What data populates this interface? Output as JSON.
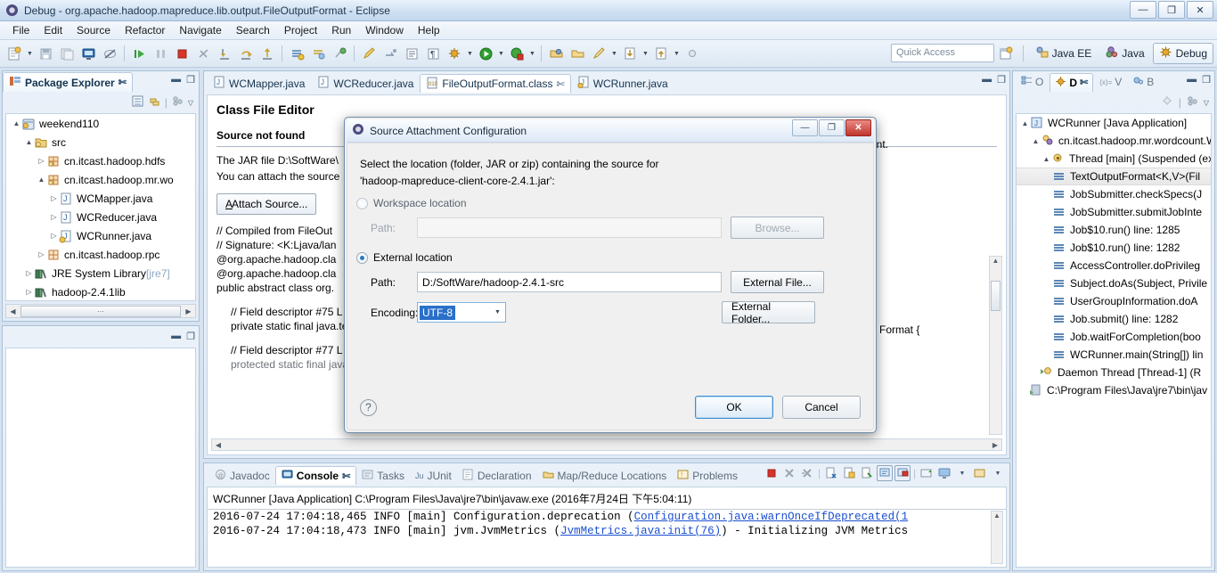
{
  "window": {
    "title": "Debug - org.apache.hadoop.mapreduce.lib.output.FileOutputFormat - Eclipse",
    "minimize": "—",
    "restore": "❐",
    "close": "✕"
  },
  "menu": [
    "File",
    "Edit",
    "Source",
    "Refactor",
    "Navigate",
    "Search",
    "Project",
    "Run",
    "Window",
    "Help"
  ],
  "toolbar": {
    "quick_access_placeholder": "Quick Access",
    "perspectives": [
      {
        "label": "Java EE",
        "active": false
      },
      {
        "label": "Java",
        "active": false
      },
      {
        "label": "Debug",
        "active": true
      }
    ]
  },
  "package_explorer": {
    "tab_label": "Package Explorer",
    "tree": [
      {
        "indent": 0,
        "twisty": "▲",
        "icon": "project",
        "label": "weekend110"
      },
      {
        "indent": 1,
        "twisty": "▲",
        "icon": "srcfolder",
        "label": "src"
      },
      {
        "indent": 2,
        "twisty": "▷",
        "icon": "package",
        "label": "cn.itcast.hadoop.hdfs"
      },
      {
        "indent": 2,
        "twisty": "▲",
        "icon": "package",
        "label": "cn.itcast.hadoop.mr.wo"
      },
      {
        "indent": 3,
        "twisty": "▷",
        "icon": "javafile",
        "label": "WCMapper.java"
      },
      {
        "indent": 3,
        "twisty": "▷",
        "icon": "javafile",
        "label": "WCReducer.java"
      },
      {
        "indent": 3,
        "twisty": "▷",
        "icon": "javafile-warn",
        "label": "WCRunner.java"
      },
      {
        "indent": 2,
        "twisty": "▷",
        "icon": "package-plain",
        "label": "cn.itcast.hadoop.rpc"
      },
      {
        "indent": 1,
        "twisty": "▷",
        "icon": "library",
        "label": "JRE System Library ",
        "suffix": "[jre7]"
      },
      {
        "indent": 1,
        "twisty": "▷",
        "icon": "library",
        "label": "hadoop-2.4.1lib"
      }
    ]
  },
  "editor": {
    "tabs": [
      {
        "label": "WCMapper.java",
        "icon": "java-file-icon",
        "active": false
      },
      {
        "label": "WCReducer.java",
        "icon": "java-file-icon",
        "active": false
      },
      {
        "label": "FileOutputFormat.class",
        "icon": "class-file-icon",
        "active": true
      },
      {
        "label": "WCRunner.java",
        "icon": "java-warn-file-icon",
        "active": false
      }
    ],
    "class_file_editor_title": "Class File Editor",
    "source_not_found_title": "Source not found",
    "message_line1": "The JAR file D:\\SoftWare\\",
    "message_line2": "You can attach the source",
    "message_right_fragment": "ment.",
    "attach_source_button": "Attach Source...",
    "code_lines": [
      "// Compiled from FileOut",
      "// Signature: <K:Ljava/lan",
      "@org.apache.hadoop.cla",
      "@org.apache.hadoop.cla",
      "public abstract class org."
    ],
    "code_block2": [
      "// Field descriptor #75 L",
      "private static final java.te"
    ],
    "code_block3": [
      "// Field descriptor #77 L",
      "protected static final java.lang.String BASE_OUTPUT_NAME = \"mapreduce.output.basename\";"
    ],
    "right_fragment": "Format {"
  },
  "dialog": {
    "title": "Source Attachment Configuration",
    "minimize": "—",
    "maximize": "❐",
    "close": "✕",
    "intro_line1": "Select the location (folder, JAR or zip) containing the source for",
    "intro_line2": "'hadoop-mapreduce-client-core-2.4.1.jar':",
    "workspace_option": "Workspace location",
    "workspace_path_label": "Path:",
    "workspace_path_value": "",
    "browse_button": "Browse...",
    "external_option": "External location",
    "external_path_label": "Path:",
    "external_path_value": "D:/SoftWare/hadoop-2.4.1-src",
    "external_file_button": "External File...",
    "encoding_label": "Encoding:",
    "encoding_value": "UTF-8",
    "external_folder_button": "External Folder...",
    "help_glyph": "?",
    "ok_button": "OK",
    "cancel_button": "Cancel"
  },
  "debug_view": {
    "tabs": [
      {
        "label": "O",
        "active": false
      },
      {
        "label": "D",
        "active": true
      },
      {
        "label": "V",
        "active": false
      },
      {
        "label": "B",
        "active": false
      }
    ],
    "tree": [
      {
        "indent": 0,
        "twisty": "▲",
        "icon": "launch",
        "label": "WCRunner [Java Application]",
        "selected": false
      },
      {
        "indent": 1,
        "twisty": "▲",
        "icon": "vm",
        "label": "cn.itcast.hadoop.mr.wordcount.W(",
        "selected": false
      },
      {
        "indent": 2,
        "twisty": "▲",
        "icon": "thread",
        "label": "Thread [main] (Suspended (ex",
        "selected": false
      },
      {
        "indent": 3,
        "twisty": "",
        "icon": "frame",
        "label": "TextOutputFormat<K,V>(Fil",
        "selected": true
      },
      {
        "indent": 3,
        "twisty": "",
        "icon": "frame",
        "label": "JobSubmitter.checkSpecs(J",
        "selected": false
      },
      {
        "indent": 3,
        "twisty": "",
        "icon": "frame",
        "label": "JobSubmitter.submitJobInte",
        "selected": false
      },
      {
        "indent": 3,
        "twisty": "",
        "icon": "frame",
        "label": "Job$10.run() line: 1285",
        "selected": false
      },
      {
        "indent": 3,
        "twisty": "",
        "icon": "frame",
        "label": "Job$10.run() line: 1282",
        "selected": false
      },
      {
        "indent": 3,
        "twisty": "",
        "icon": "frame",
        "label": "AccessController.doPrivileg",
        "selected": false
      },
      {
        "indent": 3,
        "twisty": "",
        "icon": "frame",
        "label": "Subject.doAs(Subject, Privile",
        "selected": false
      },
      {
        "indent": 3,
        "twisty": "",
        "icon": "frame",
        "label": "UserGroupInformation.doA",
        "selected": false
      },
      {
        "indent": 3,
        "twisty": "",
        "icon": "frame",
        "label": "Job.submit() line: 1282",
        "selected": false
      },
      {
        "indent": 3,
        "twisty": "",
        "icon": "frame",
        "label": "Job.waitForCompletion(boo",
        "selected": false
      },
      {
        "indent": 3,
        "twisty": "",
        "icon": "frame",
        "label": "WCRunner.main(String[]) lin",
        "selected": false
      },
      {
        "indent": 2,
        "twisty": "",
        "icon": "thread",
        "label": "Daemon Thread [Thread-1] (R",
        "selected": false
      },
      {
        "indent": 1,
        "twisty": "",
        "icon": "process",
        "label": "C:\\Program Files\\Java\\jre7\\bin\\jav",
        "selected": false
      }
    ]
  },
  "console": {
    "tabs": [
      {
        "label": "Javadoc",
        "icon": "javadoc-icon",
        "active": false
      },
      {
        "label": "Console",
        "icon": "console-icon",
        "active": true
      },
      {
        "label": "Tasks",
        "icon": "tasks-icon",
        "active": false
      },
      {
        "label": "JUnit",
        "icon": "junit-icon",
        "active": false
      },
      {
        "label": "Declaration",
        "icon": "declaration-icon",
        "active": false
      },
      {
        "label": "Map/Reduce Locations",
        "icon": "mapreduce-icon",
        "active": false
      },
      {
        "label": "Problems",
        "icon": "problems-icon",
        "active": false
      }
    ],
    "header": "WCRunner [Java Application] C:\\Program Files\\Java\\jre7\\bin\\javaw.exe (2016年7月24日 下午5:04:11)",
    "lines": [
      {
        "text": "2016-07-24 17:04:18,465 INFO  [main] Configuration.deprecation (",
        "link": "Configuration.java:warnOnceIfDeprecated(1",
        "tail": ""
      },
      {
        "text": "2016-07-24 17:04:18,473 INFO  [main] jvm.JvmMetrics (",
        "link": "JvmMetrics.java:init(76)",
        "tail": ") - Initializing JVM Metrics"
      }
    ]
  }
}
